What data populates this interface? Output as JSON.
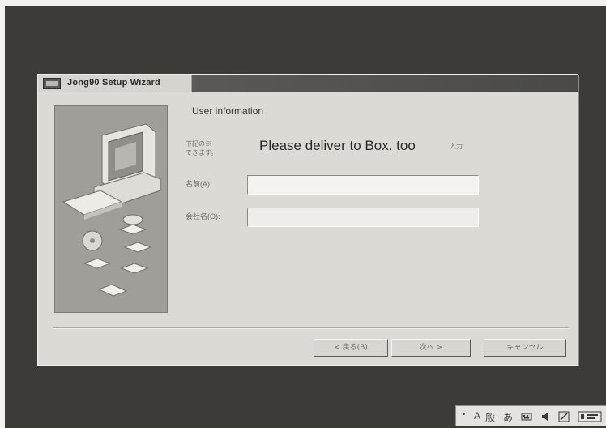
{
  "window": {
    "title": "Jong90 Setup Wizard"
  },
  "page": {
    "heading": "User information",
    "instruction_line1": "下記の※",
    "instruction_line2": "できます。",
    "overlay_caption": "Please deliver to Box. too",
    "instruction_tail": "入力"
  },
  "fields": {
    "name_label": "名前(A):",
    "name_value": "",
    "company_label": "会社名(O):",
    "company_value": ""
  },
  "buttons": {
    "back": "< 戻る(B)",
    "next": "次へ >",
    "cancel": "キャンセル"
  },
  "tray": {
    "glyphs": [
      "A",
      "般",
      "あ"
    ],
    "icons": [
      "keyboard-icon",
      "speaker-icon",
      "pen-icon",
      "help-icon"
    ]
  },
  "colors": {
    "desktop": "#3c3b38",
    "dialog": "#dcdad4",
    "titlebar_dark": "#4a4946",
    "banner": "#9f9e98"
  }
}
